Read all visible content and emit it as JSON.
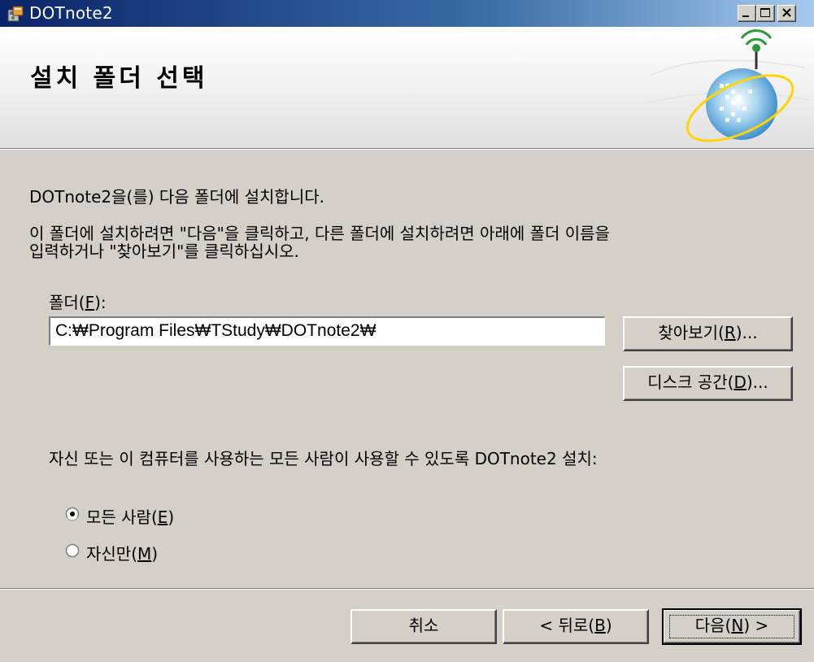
{
  "window": {
    "title": "DOTnote2",
    "buttons": {
      "minimize": "minimize",
      "maximize": "maximize",
      "close": "close"
    }
  },
  "banner": {
    "title": "설치 폴더 선택"
  },
  "intro": {
    "line1": "DOTnote2을(를) 다음 폴더에 설치합니다.",
    "line2": "이 폴더에 설치하려면 \"다음\"을 클릭하고, 다른 폴더에 설치하려면 아래에 폴더 이름을",
    "line3": "입력하거나 \"찾아보기\"를 클릭하십시오."
  },
  "folder": {
    "label_prefix": "폴더(",
    "label_key": "F",
    "label_suffix": "):",
    "value": "C:₩Program Files₩TStudy₩DOTnote2₩"
  },
  "buttons": {
    "browse": {
      "prefix": "찾아보기(",
      "key": "R",
      "suffix": ")..."
    },
    "disk_space": {
      "prefix": "디스크 공간(",
      "key": "D",
      "suffix": ")..."
    },
    "cancel": "취소",
    "back": {
      "prefix": "< 뒤로(",
      "key": "B",
      "suffix": ")"
    },
    "next": {
      "prefix": "다음(",
      "key": "N",
      "suffix": ") >"
    }
  },
  "install_for": {
    "label": "자신 또는 이 컴퓨터를 사용하는 모든 사람이 사용할 수 있도록 DOTnote2 설치:",
    "options": [
      {
        "prefix": "모든 사람(",
        "key": "E",
        "suffix": ")",
        "selected": true
      },
      {
        "prefix": "자신만(",
        "key": "M",
        "suffix": ")",
        "selected": false
      }
    ]
  }
}
